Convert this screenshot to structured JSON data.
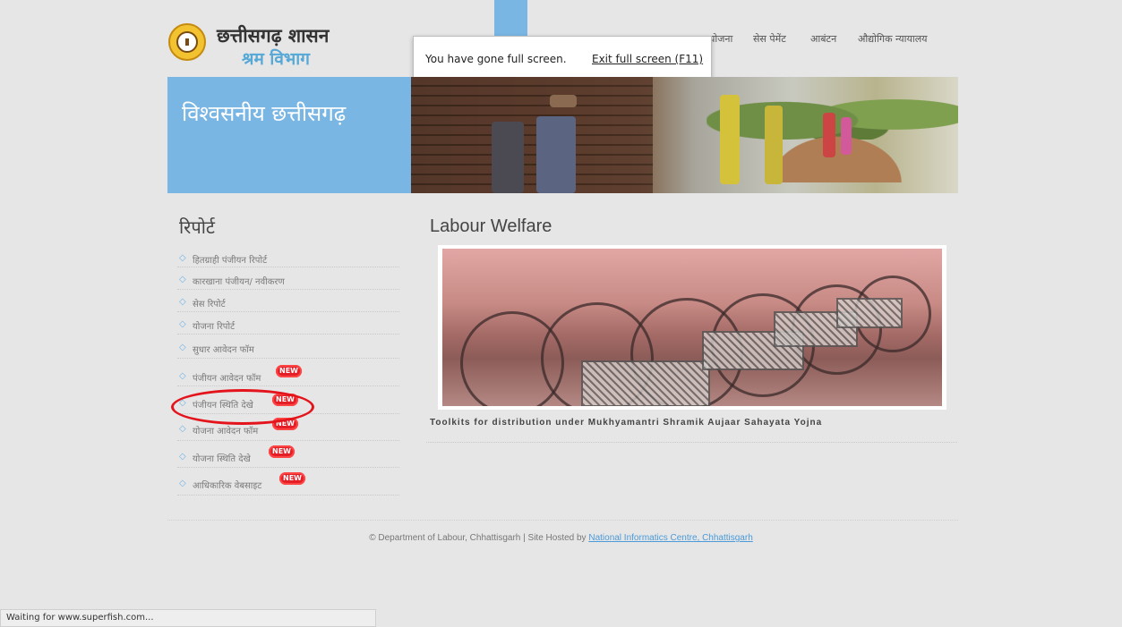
{
  "header": {
    "site_title": "छत्तीसगढ़ शासन",
    "site_subtitle": "श्रम विभाग",
    "nav": [
      "योजना",
      "सेस पेमेंट",
      "आबंटन",
      "औद्योगिक न्यायालय"
    ]
  },
  "fullscreen_notice": {
    "message": "You have gone full screen.",
    "exit_link": "Exit full screen (F11)"
  },
  "banner": {
    "tagline": "विश्वसनीय छत्तीसगढ़"
  },
  "sidebar": {
    "heading": "रिपोर्ट",
    "new_badge": "NEW",
    "items": [
      {
        "label": "हितग्राही पंजीयन रिपोर्ट",
        "new": false
      },
      {
        "label": "कारखाना पंजीयन/ नवीकरण",
        "new": false
      },
      {
        "label": "सेस रिपोर्ट",
        "new": false
      },
      {
        "label": "योजना रिपोर्ट",
        "new": false
      },
      {
        "label": "सुधार आवेदन फॉम",
        "new": false
      },
      {
        "label": "पंजीयन आवेदन फॉम",
        "new": true
      },
      {
        "label": "पंजीयन स्थिति देखे",
        "new": true
      },
      {
        "label": "योजना आवेदन फॉम",
        "new": true
      },
      {
        "label": "योजना स्थिति देखे",
        "new": true
      },
      {
        "label": "आधिकारिक वेबसाइट",
        "new": true
      }
    ]
  },
  "main": {
    "title": "Labour Welfare",
    "caption": "Toolkits for distribution under Mukhyamantri Shramik Aujaar Sahayata Yojna"
  },
  "footer": {
    "text": "© Department of Labour, Chhattisgarh | Site Hosted by ",
    "link": "National Informatics Centre, Chhattisgarh"
  },
  "statusbar": {
    "text": "Waiting for www.superfish.com..."
  },
  "colors": {
    "accent_blue": "#7ab6e4",
    "highlight_red": "#e3141b"
  }
}
